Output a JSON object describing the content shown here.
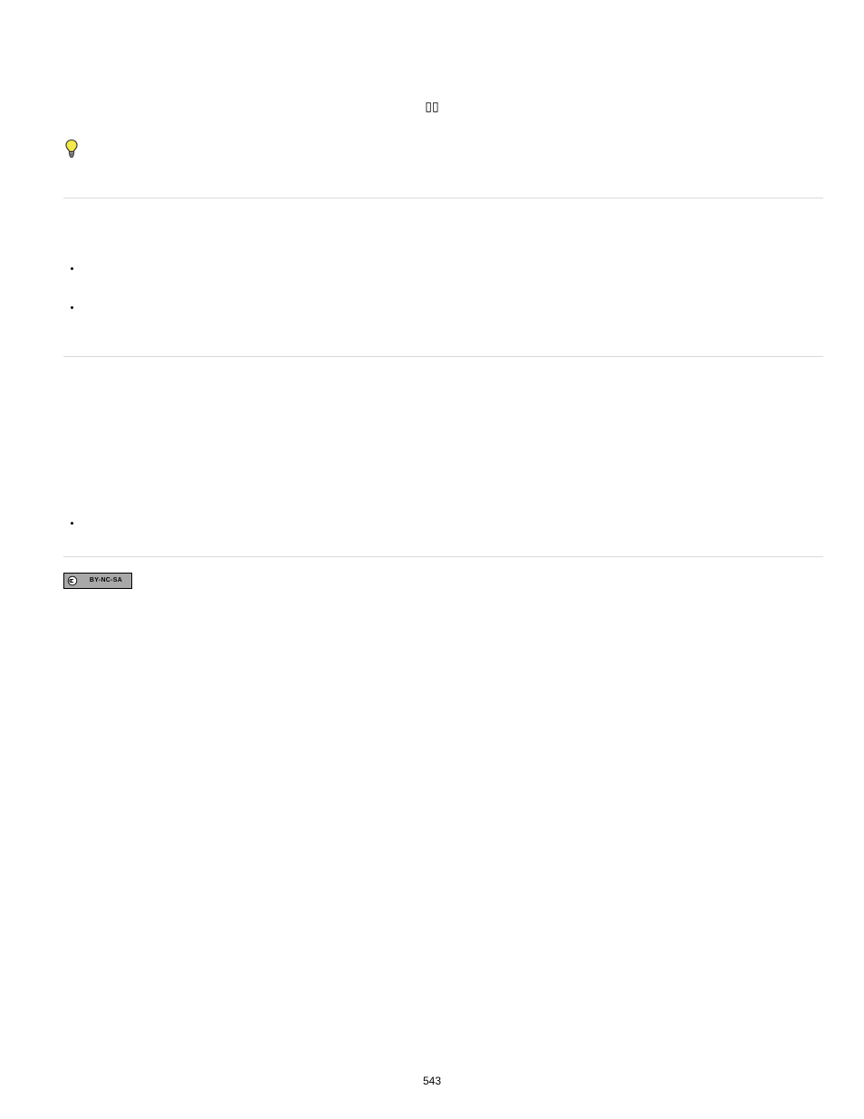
{
  "header": {
    "symbol": "▯▯"
  },
  "icons": {
    "bulb": "lightbulb-icon"
  },
  "bullets_group_1": [
    "",
    ""
  ],
  "bullets_group_2": [
    ""
  ],
  "cc": {
    "label": "BY-NC-SA"
  },
  "page_number": "543"
}
